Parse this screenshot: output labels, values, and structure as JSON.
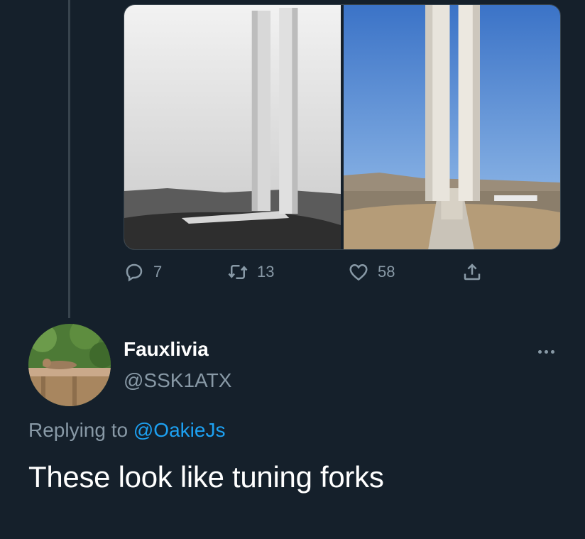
{
  "parent_tweet": {
    "media": [
      {
        "icon": "photo-monument-bw"
      },
      {
        "icon": "photo-monument-color"
      }
    ],
    "actions": {
      "reply_count": "7",
      "retweet_count": "13",
      "like_count": "58"
    }
  },
  "reply_tweet": {
    "display_name": "Fauxlivia",
    "handle": "@SSK1ATX",
    "replying_prefix": "Replying to",
    "replying_mention": "@OakieJs",
    "text": "These look like tuning forks"
  },
  "colors": {
    "background": "#15202b",
    "secondary_text": "#8899a6",
    "link": "#1da1f2",
    "border": "#38444d"
  }
}
